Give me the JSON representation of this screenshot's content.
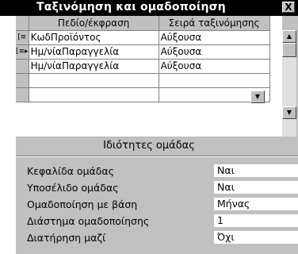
{
  "window": {
    "title": "Ταξινόμηση και ομαδοποίηση",
    "close_label": "X"
  },
  "grid": {
    "headers": [
      "Πεδίο/έκφραση",
      "Σειρά ταξινόμησης"
    ],
    "rows": [
      {
        "selector": "[≡",
        "field": "ΚωδΠροϊόντος",
        "order": "Αύξουσα"
      },
      {
        "selector": "[≡▸",
        "field": "Ημ/νίαΠαραγγελία",
        "order": "Αύξουσα"
      },
      {
        "selector": "",
        "field": "Ημ/νίαΠαραγγελία",
        "order": "Αύξουσα"
      },
      {
        "selector": "",
        "field": "",
        "order": ""
      },
      {
        "selector": "",
        "field": "",
        "order": ""
      }
    ]
  },
  "group_properties": {
    "title": "Ιδιότητες ομάδας",
    "items": [
      {
        "label": "Κεφαλίδα ομάδας",
        "value": "Ναι"
      },
      {
        "label": "Υποσέλιδο ομάδας",
        "value": "Ναι"
      },
      {
        "label": "Ομαδοποίηση με βάση",
        "value": "Μήνας"
      },
      {
        "label": "Διάστημα ομαδοποίησης",
        "value": "1"
      },
      {
        "label": "Διατήρηση μαζί",
        "value": "Όχι"
      }
    ]
  },
  "icons": {
    "dropdown": "chevron-down-icon",
    "scroll_up": "arrow-up-icon",
    "scroll_down": "arrow-down-icon"
  }
}
